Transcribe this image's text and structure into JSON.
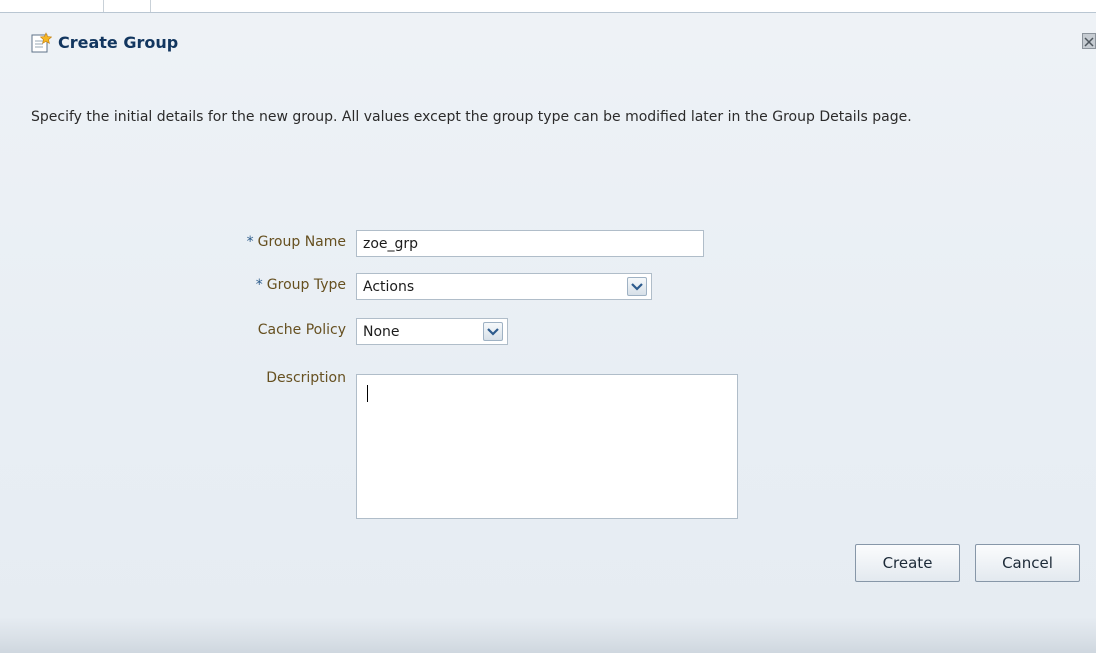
{
  "dialog": {
    "title": "Create Group",
    "instructions": "Specify the initial details for the new group. All values except the group type can be modified later in the Group Details page."
  },
  "form": {
    "required_marker": "*",
    "group_name": {
      "label": "Group Name",
      "value": "zoe_grp"
    },
    "group_type": {
      "label": "Group Type",
      "value": "Actions"
    },
    "cache_policy": {
      "label": "Cache Policy",
      "value": "None"
    },
    "description": {
      "label": "Description",
      "value": ""
    }
  },
  "buttons": {
    "create": "Create",
    "cancel": "Cancel"
  },
  "icons": {
    "title": "new-item-icon",
    "close": "close-icon",
    "dropdown": "chevron-down-icon"
  },
  "colors": {
    "title": "#12365f",
    "label": "#665020",
    "required": "#2a5a8a"
  }
}
